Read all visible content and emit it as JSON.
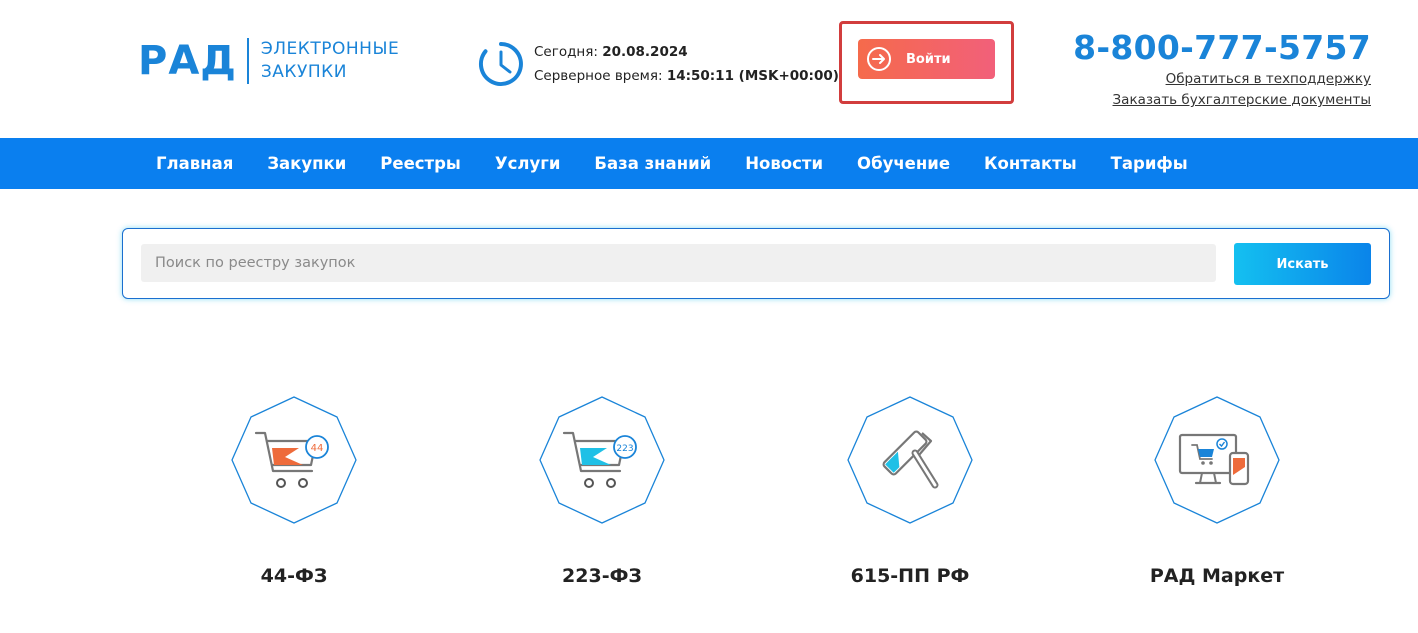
{
  "header": {
    "logo": {
      "mark": "РАД",
      "line1": "ЭЛЕКТРОННЫЕ",
      "line2": "ЗАКУПКИ"
    },
    "today_label": "Сегодня:",
    "today_value": "20.08.2024",
    "server_time_label": "Серверное время:",
    "server_time_value": "14:50:11 (MSK+00:00)",
    "login_label": "Войти",
    "phone": "8-800-777-5757",
    "support_link": "Обратиться в техподдержку",
    "docs_link": "Заказать бухгалтерские документы"
  },
  "nav": {
    "items": [
      "Главная",
      "Закупки",
      "Реестры",
      "Услуги",
      "База знаний",
      "Новости",
      "Обучение",
      "Контакты",
      "Тарифы"
    ]
  },
  "search": {
    "placeholder": "Поиск по реестру закупок",
    "value": "",
    "button_label": "Искать"
  },
  "categories": [
    {
      "label": "44-ФЗ",
      "icon": "cart-44-icon",
      "badge": "44"
    },
    {
      "label": "223-ФЗ",
      "icon": "cart-223-icon",
      "badge": "223"
    },
    {
      "label": "615-ПП РФ",
      "icon": "paint-roller-icon"
    },
    {
      "label": "РАД Маркет",
      "icon": "monitor-phone-icon"
    }
  ],
  "colors": {
    "brand_blue": "#1a84d8",
    "nav_blue": "#0a7fef",
    "login_gradient": [
      "#f56a4b",
      "#f2607a"
    ],
    "highlight_red": "#d23d3d",
    "search_gradient": [
      "#14c0f0",
      "#0a84ea"
    ]
  }
}
